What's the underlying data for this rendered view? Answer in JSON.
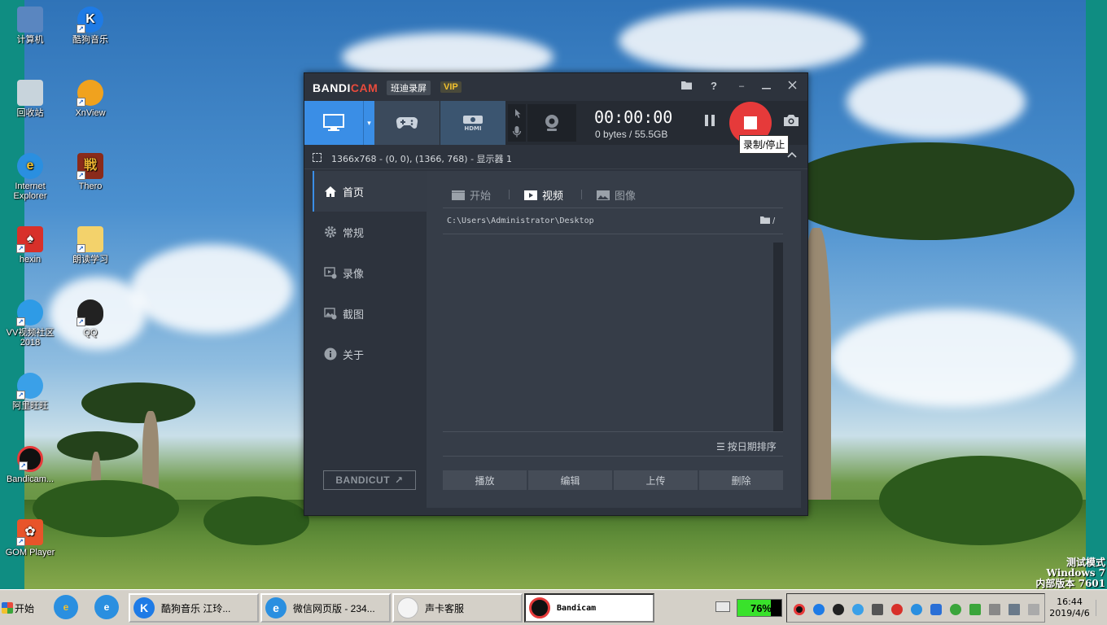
{
  "desktop": {
    "icons": [
      {
        "label": "计算机",
        "icon": "computer-icon"
      },
      {
        "label": "酷狗音乐",
        "icon": "kugou-icon"
      },
      {
        "label": "回收站",
        "icon": "recycle-bin-icon"
      },
      {
        "label": "XnView",
        "icon": "xnview-icon"
      },
      {
        "label": "Internet Explorer",
        "icon": "ie-icon"
      },
      {
        "label": "Thero",
        "icon": "thero-icon"
      },
      {
        "label": "hexin",
        "icon": "hexin-icon"
      },
      {
        "label": "朗读学习",
        "icon": "folder-icon"
      },
      {
        "label": "VV视频社区 2018",
        "icon": "vv-icon"
      },
      {
        "label": "QQ",
        "icon": "qq-icon"
      },
      {
        "label": "阿里旺旺",
        "icon": "aliwangwang-icon"
      },
      {
        "label": "Bandicam...",
        "icon": "bandicam-icon"
      },
      {
        "label": "GOM Player",
        "icon": "gom-icon"
      }
    ],
    "watermark": [
      "测试模式",
      "Windows 7",
      "内部版本 7601"
    ]
  },
  "bandicam": {
    "brand": "BANDI",
    "brand_accent": "CAM",
    "cn_name": "班迪录屏",
    "vip": "VIP",
    "title_buttons": {
      "help": "?",
      "minimize": "–"
    },
    "timer": "00:00:00",
    "size_info": "0 bytes / 55.5GB",
    "tooltip": "录制/停止",
    "area": "1366x768 - (0, 0), (1366, 768) - 显示器 1",
    "sidebar": [
      {
        "label": "首页",
        "icon": "home-icon",
        "active": true
      },
      {
        "label": "常规",
        "icon": "gear-icon",
        "active": false
      },
      {
        "label": "录像",
        "icon": "video-settings-icon",
        "active": false
      },
      {
        "label": "截图",
        "icon": "image-settings-icon",
        "active": false
      },
      {
        "label": "关于",
        "icon": "info-icon",
        "active": false
      }
    ],
    "bandicut": "BANDICUT",
    "tabs": [
      {
        "label": "开始"
      },
      {
        "label": "视频"
      },
      {
        "label": "图像"
      }
    ],
    "path": "C:\\Users\\Administrator\\Desktop",
    "path_suffix": "/",
    "sort": "按日期排序",
    "actions": [
      "播放",
      "编辑",
      "上传",
      "删除"
    ],
    "colors": {
      "accent": "#3a8ee6",
      "record": "#e63a3a",
      "brand_red": "#e84b3c",
      "vip": "#f2c12e"
    }
  },
  "taskbar": {
    "start": "开始",
    "tasks": [
      "酷狗音乐 江玲...",
      "微信网页版 - 234...",
      "声卡客服",
      "Bandicam"
    ],
    "cpu_label": "76%",
    "cpu_percent": 76,
    "time": "16:44",
    "date": "2019/4/6"
  }
}
